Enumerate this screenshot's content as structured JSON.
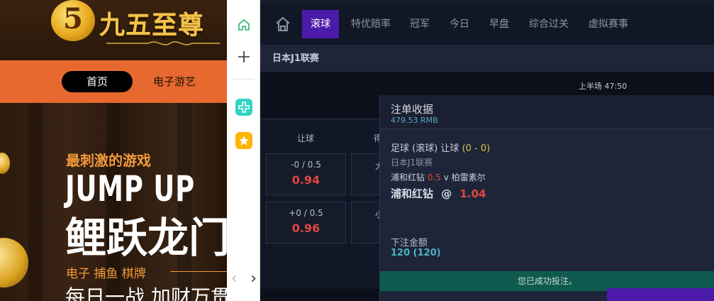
{
  "website": {
    "logo_glyph": "5",
    "logo_text": "九五至尊",
    "nav": {
      "active": "首页",
      "items": [
        "电子游艺"
      ]
    },
    "banner": {
      "tagline": "最刺激的游戏",
      "headline_en": "JUMP UP",
      "headline_cn": "鲤跃龙门",
      "categories": "电子  捕鱼  棋牌",
      "slogan": "每日一战 加财万贯"
    }
  },
  "sidebar": {
    "icons": [
      "home-icon",
      "plus-icon",
      "cross-app-icon",
      "star-app-icon"
    ],
    "pager": {
      "prev": "‹",
      "next": "›"
    }
  },
  "sportsbook": {
    "tabs": [
      "滚球",
      "特优赔率",
      "冠军",
      "今日",
      "早盘",
      "综合过关",
      "虚拟赛事"
    ],
    "active_tab": "滚球",
    "league": "日本J1联赛",
    "period": "上半场  47:50",
    "columns": [
      "让球",
      "得"
    ],
    "odds": [
      {
        "line": "-0 / 0.5",
        "price": "0.94"
      },
      {
        "line": "大",
        "price": ""
      },
      {
        "line": "+0 / 0.5",
        "price": "0.96"
      },
      {
        "line": "小",
        "price": ""
      }
    ]
  },
  "bet_slip": {
    "title": "注单收据",
    "balance": "479.53 RMB",
    "market": "足球 (滚球) 让球",
    "score": "(0 - 0)",
    "league": "日本J1联赛",
    "home": "浦和红钻",
    "handicap": "0.5",
    "vs": "v",
    "away": "柏雷素尔",
    "selection": "浦和红钻",
    "at": "@",
    "price": "1.04",
    "stake_label": "下注金额",
    "stake": "120 (120)",
    "success": "您已成功投注。"
  },
  "colors": {
    "accent_purple": "#4b1aa8",
    "odds_red": "#e0473f",
    "success_green": "#0f5a4e",
    "site_orange": "#e8692f"
  }
}
